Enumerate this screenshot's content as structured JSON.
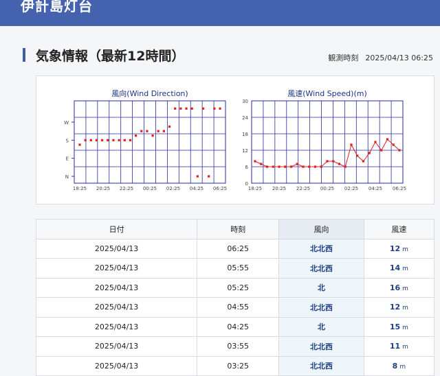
{
  "header": {
    "title": "伊計島灯台"
  },
  "section": {
    "title": "気象情報（最新12時間）",
    "obs_label": "観測時刻",
    "obs_value": "2025/04/13 06:25"
  },
  "colors": {
    "header_bg": "#4462ad",
    "grid": "#2a2aa0",
    "point": "#e11d1d",
    "link": "#1f3f86"
  },
  "chart_data": [
    {
      "type": "scatter",
      "title": "風向(Wind Direction)",
      "x_tick_labels": [
        "18:25",
        "20:25",
        "22:25",
        "00:25",
        "02:25",
        "04:25",
        "06:25"
      ],
      "y_tick_labels": [
        "N",
        "E",
        "S",
        "W"
      ],
      "ylim": [
        0,
        360
      ],
      "y_ticks": [
        0,
        90,
        180,
        270
      ],
      "x": [
        "18:25",
        "18:55",
        "19:25",
        "19:55",
        "20:25",
        "20:55",
        "21:25",
        "21:55",
        "22:25",
        "22:55",
        "23:25",
        "23:55",
        "00:25",
        "00:55",
        "01:25",
        "01:55",
        "02:25",
        "02:55",
        "03:25",
        "03:55",
        "04:25",
        "04:55",
        "05:25",
        "05:55",
        "06:25"
      ],
      "values": [
        157.5,
        180,
        180,
        180,
        180,
        180,
        180,
        180,
        180,
        180,
        202.5,
        225,
        225,
        202.5,
        225,
        225,
        247.5,
        337.5,
        337.5,
        337.5,
        337.5,
        0,
        337.5,
        0,
        337.5,
        337.5
      ],
      "grid": true
    },
    {
      "type": "line",
      "title": "風速(Wind Speed)(m)",
      "x_tick_labels": [
        "18:25",
        "20:25",
        "22:25",
        "00:25",
        "02:25",
        "04:25",
        "06:25"
      ],
      "y_ticks": [
        0,
        6,
        12,
        18,
        24,
        30
      ],
      "ylim": [
        0,
        30
      ],
      "values": [
        8,
        7,
        6,
        6,
        6,
        6,
        6,
        7,
        6,
        6,
        6,
        6,
        8,
        8,
        7,
        6,
        14,
        10,
        8,
        11,
        15,
        12,
        16,
        14,
        12
      ],
      "grid": true
    }
  ],
  "table": {
    "headers": [
      "日付",
      "時刻",
      "風向",
      "風速"
    ],
    "unit": "m",
    "rows": [
      {
        "date": "2025/04/13",
        "time": "06:25",
        "dir": "北北西",
        "speed": "12"
      },
      {
        "date": "2025/04/13",
        "time": "05:55",
        "dir": "北北西",
        "speed": "14"
      },
      {
        "date": "2025/04/13",
        "time": "05:25",
        "dir": "北",
        "speed": "16"
      },
      {
        "date": "2025/04/13",
        "time": "04:55",
        "dir": "北北西",
        "speed": "12"
      },
      {
        "date": "2025/04/13",
        "time": "04:25",
        "dir": "北",
        "speed": "15"
      },
      {
        "date": "2025/04/13",
        "time": "03:55",
        "dir": "北北西",
        "speed": "11"
      },
      {
        "date": "2025/04/13",
        "time": "03:25",
        "dir": "北北西",
        "speed": "8"
      }
    ]
  }
}
